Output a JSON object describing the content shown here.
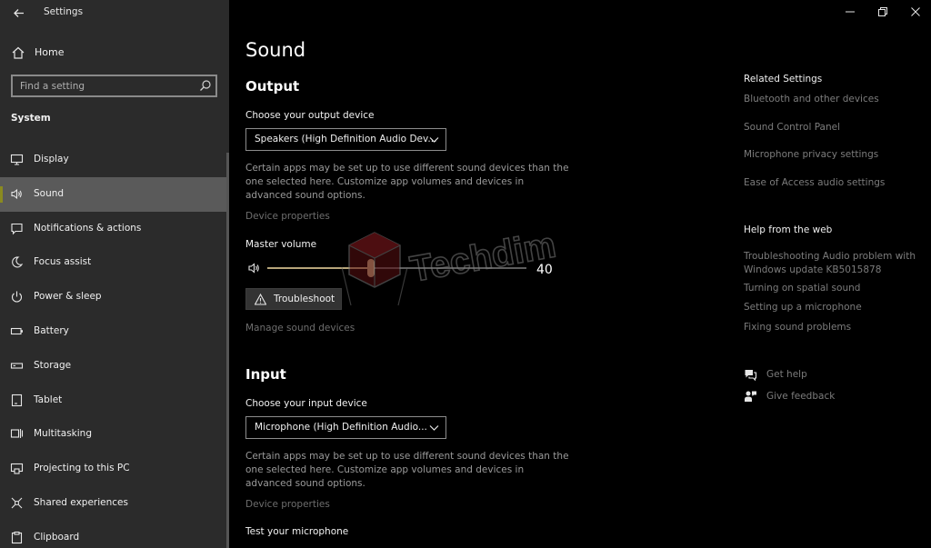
{
  "window": {
    "title": "Settings",
    "controls": {
      "minimize": "minimize-icon",
      "restore": "restore-icon",
      "close": "close-icon"
    }
  },
  "sidebar": {
    "home_label": "Home",
    "search": {
      "placeholder": "Find a setting",
      "value": ""
    },
    "section_label": "System",
    "items": [
      {
        "label": "Display",
        "icon": "monitor-icon",
        "active": false
      },
      {
        "label": "Sound",
        "icon": "speaker-icon",
        "active": true
      },
      {
        "label": "Notifications & actions",
        "icon": "notifications-icon",
        "active": false
      },
      {
        "label": "Focus assist",
        "icon": "moon-icon",
        "active": false
      },
      {
        "label": "Power & sleep",
        "icon": "power-icon",
        "active": false
      },
      {
        "label": "Battery",
        "icon": "battery-icon",
        "active": false
      },
      {
        "label": "Storage",
        "icon": "storage-icon",
        "active": false
      },
      {
        "label": "Tablet",
        "icon": "tablet-icon",
        "active": false
      },
      {
        "label": "Multitasking",
        "icon": "multitasking-icon",
        "active": false
      },
      {
        "label": "Projecting to this PC",
        "icon": "projecting-icon",
        "active": false
      },
      {
        "label": "Shared experiences",
        "icon": "shared-experiences-icon",
        "active": false
      },
      {
        "label": "Clipboard",
        "icon": "clipboard-icon",
        "active": false
      }
    ]
  },
  "main": {
    "title": "Sound",
    "output": {
      "heading": "Output",
      "device_label": "Choose your output device",
      "device_value": "Speakers (High Definition Audio Dev...",
      "description": "Certain apps may be set up to use different sound devices than the one selected here. Customize app volumes and devices in advanced sound options.",
      "device_properties": "Device properties",
      "master_volume_label": "Master volume",
      "volume": 40,
      "volume_text": "40",
      "troubleshoot_label": "Troubleshoot",
      "manage_devices": "Manage sound devices"
    },
    "input": {
      "heading": "Input",
      "device_label": "Choose your input device",
      "device_value": "Microphone (High Definition Audio...",
      "description": "Certain apps may be set up to use different sound devices than the one selected here. Customize app volumes and devices in advanced sound options.",
      "device_properties": "Device properties",
      "test_label": "Test your microphone"
    }
  },
  "related": {
    "heading": "Related Settings",
    "links": [
      "Bluetooth and other devices",
      "Sound Control Panel",
      "Microphone privacy settings",
      "Ease of Access audio settings"
    ]
  },
  "help": {
    "heading": "Help from the web",
    "links": [
      "Troubleshooting Audio problem with Windows update KB5015878",
      "Turning on spatial sound",
      "Setting up a microphone",
      "Fixing sound problems"
    ],
    "get_help": "Get help",
    "give_feedback": "Give feedback"
  },
  "watermark": {
    "text": "Techdim"
  },
  "colors": {
    "sidebar_bg": "#2b2b2b",
    "active_item_bg": "#5a5a5a",
    "accent": "#b7a57a",
    "main_bg": "#000000"
  }
}
